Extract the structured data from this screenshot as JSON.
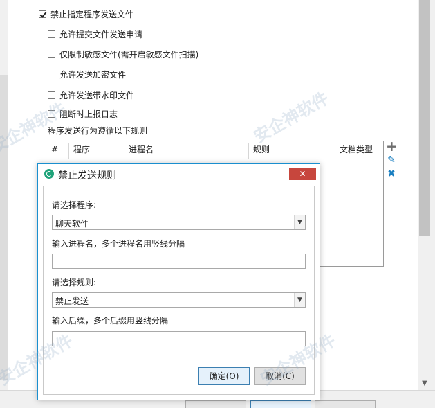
{
  "options": {
    "main_checkbox": {
      "label": "禁止指定程序发送文件",
      "checked": true
    },
    "sub_checkboxes": [
      {
        "label": "允许提交文件发送申请",
        "checked": false
      },
      {
        "label": "仅限制敏感文件(需开启敏感文件扫描)",
        "checked": false
      },
      {
        "label": "允许发送加密文件",
        "checked": false
      },
      {
        "label": "允许发送带水印文件",
        "checked": false
      },
      {
        "label": "阻断时上报日志",
        "checked": false
      }
    ],
    "rules_caption": "程序发送行为遵循以下规则"
  },
  "table": {
    "columns": [
      "#",
      "程序",
      "进程名",
      "规则",
      "文档类型"
    ]
  },
  "side_actions": {
    "add": "+",
    "edit": "✎",
    "delete": "✖"
  },
  "dialog": {
    "title": "禁止发送规则",
    "close": "✕",
    "program_label": "请选择程序:",
    "program_value": "聊天软件",
    "process_label": "输入进程名，多个进程名用竖线分隔",
    "process_value": "",
    "rule_label": "请选择规则:",
    "rule_value": "禁止发送",
    "suffix_label": "输入后缀，多个后缀用竖线分隔",
    "suffix_value": "",
    "ok": "确定(O)",
    "cancel": "取消(C)"
  },
  "watermark": "安企神软件",
  "colors": {
    "dialog_border": "#1a8fcf",
    "close_bg": "#c7463d",
    "icon_blue": "#1a7fc1",
    "add_gray": "#6f6f6f"
  }
}
